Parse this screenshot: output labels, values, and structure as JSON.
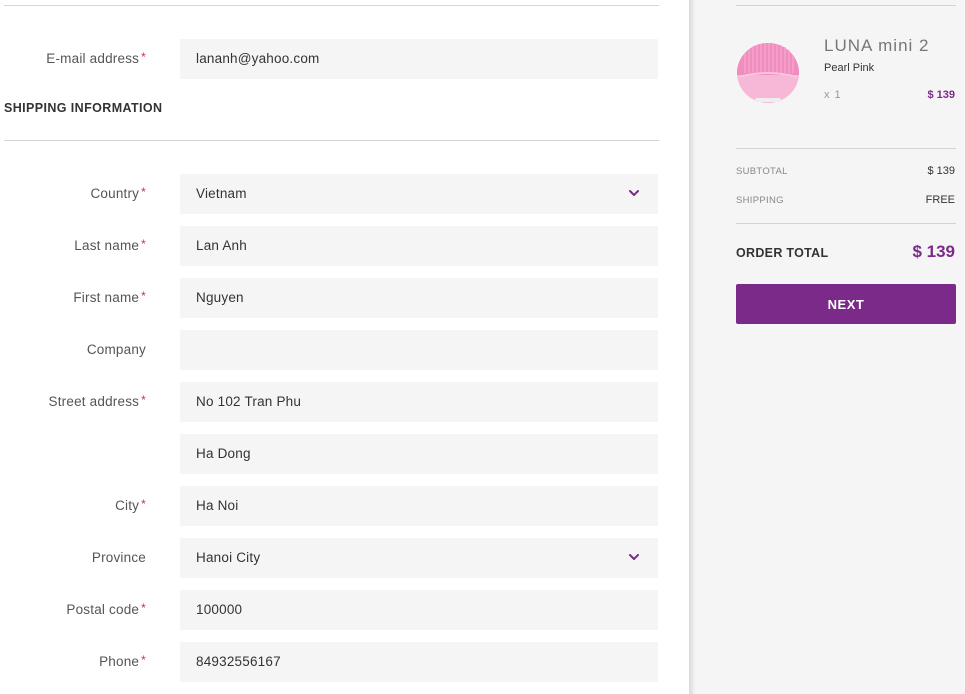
{
  "contact": {
    "email": {
      "label": "E-mail address",
      "required": "*",
      "value": "lananh@yahoo.com"
    }
  },
  "shipping": {
    "section_title": "SHIPPING INFORMATION",
    "fields": {
      "country": {
        "label": "Country",
        "required": "*",
        "value": "Vietnam",
        "icon": "chevron-down-icon"
      },
      "last_name": {
        "label": "Last name",
        "required": "*",
        "value": "Lan Anh"
      },
      "first_name": {
        "label": "First name",
        "required": "*",
        "value": "Nguyen"
      },
      "company": {
        "label": "Company",
        "value": ""
      },
      "street": {
        "label": "Street address",
        "required": "*",
        "value": "No 102 Tran Phu"
      },
      "street2": {
        "value": "Ha Dong"
      },
      "city": {
        "label": "City",
        "required": "*",
        "value": "Ha Noi"
      },
      "province": {
        "label": "Province",
        "value": "Hanoi City",
        "icon": "chevron-down-icon"
      },
      "postal_code": {
        "label": "Postal code",
        "required": "*",
        "value": "100000"
      },
      "phone": {
        "label": "Phone",
        "required": "*",
        "value": "84932556167"
      }
    }
  },
  "summary": {
    "product": {
      "name": "LUNA mini 2",
      "variant": "Pearl Pink",
      "quantity": "x 1",
      "price": "$ 139",
      "image": "pink-facial-cleansing-device"
    },
    "subtotal_label": "SUBTOTAL",
    "subtotal_value": "$ 139",
    "shipping_label": "SHIPPING",
    "shipping_value": "FREE",
    "order_total_label": "ORDER TOTAL",
    "order_total_value": "$ 139",
    "next_button": "NEXT"
  },
  "colors": {
    "accent": "#7b2a8a",
    "required": "#e0245e",
    "field_bg": "#f5f5f5",
    "summary_bg": "#f5f5f5"
  }
}
